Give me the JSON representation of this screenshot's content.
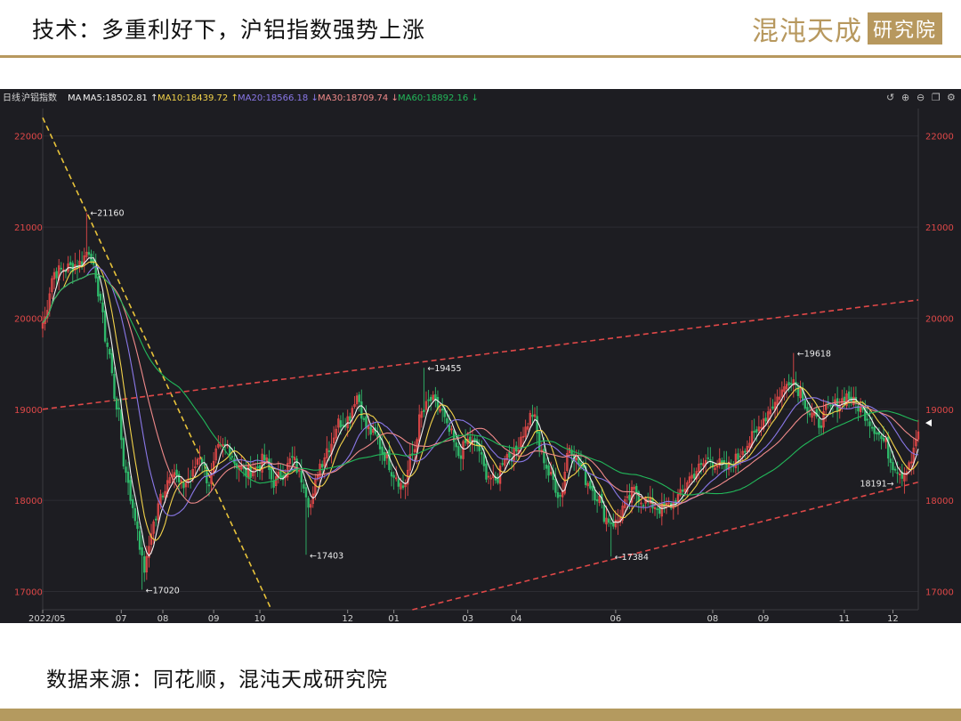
{
  "slide": {
    "title": "技术：多重利好下，沪铝指数强势上涨",
    "logo_main": "混沌天成",
    "logo_box": "研究院",
    "source": "数据来源：同花顺，混沌天成研究院"
  },
  "colors": {
    "background": "#1d1d22",
    "candle_up": "#e04848",
    "candle_down": "#2fb86a",
    "ma5": "#f2f2f2",
    "ma10": "#f3d34a",
    "ma20": "#8a78e8",
    "ma30": "#f08a8a",
    "ma60": "#22b85a",
    "trend_down": "#e8c33a",
    "trend_channel": "#e04848",
    "tick_red": "#e04848",
    "gold": "#b7985e"
  },
  "toolbar": {
    "period": "日线",
    "symbol": "沪铝指数",
    "ma_label": "MA",
    "ma": [
      {
        "label": "MA5:18502.81",
        "arrow": "↑",
        "color": "#f2f2f2"
      },
      {
        "label": "MA10:18439.72",
        "arrow": "↑",
        "color": "#f3d34a"
      },
      {
        "label": "MA20:18566.18",
        "arrow": "↓",
        "color": "#8a78e8"
      },
      {
        "label": "MA30:18709.74",
        "arrow": "↓",
        "color": "#f08a8a"
      },
      {
        "label": "MA60:18892.16",
        "arrow": "↓",
        "color": "#22b85a"
      }
    ],
    "icons": [
      "undo-icon",
      "zoom-in-icon",
      "zoom-out-icon",
      "copy-icon",
      "settings-icon"
    ]
  },
  "chart_data": {
    "type": "candlestick",
    "ylim": [
      16800,
      22300
    ],
    "y_ticks": [
      {
        "value": 22000,
        "label": "22000"
      },
      {
        "value": 21000,
        "label": "21000"
      },
      {
        "value": 20000,
        "label": "20000"
      },
      {
        "value": 19000,
        "label": "19000"
      },
      {
        "value": 18000,
        "label": "18000"
      },
      {
        "value": 17000,
        "label": "17000"
      }
    ],
    "x_ticks": [
      {
        "label": "2022/05",
        "index": 0
      },
      {
        "label": "07",
        "index": 34
      },
      {
        "label": "08",
        "index": 52
      },
      {
        "label": "09",
        "index": 74
      },
      {
        "label": "10",
        "index": 94
      },
      {
        "label": "12",
        "index": 132
      },
      {
        "label": "01",
        "index": 152
      },
      {
        "label": "03",
        "index": 184
      },
      {
        "label": "04",
        "index": 205
      },
      {
        "label": "06",
        "index": 248
      },
      {
        "label": "08",
        "index": 290
      },
      {
        "label": "09",
        "index": 312
      },
      {
        "label": "11",
        "index": 347
      },
      {
        "label": "12",
        "index": 368
      }
    ],
    "bar_count": 380,
    "anchors": [
      {
        "i": 0,
        "v": 19950
      },
      {
        "i": 5,
        "v": 20500
      },
      {
        "i": 10,
        "v": 20550
      },
      {
        "i": 16,
        "v": 20600
      },
      {
        "i": 20,
        "v": 20750
      },
      {
        "i": 24,
        "v": 20300
      },
      {
        "i": 28,
        "v": 19700
      },
      {
        "i": 32,
        "v": 19050
      },
      {
        "i": 36,
        "v": 18300
      },
      {
        "i": 40,
        "v": 17800
      },
      {
        "i": 44,
        "v": 17250
      },
      {
        "i": 48,
        "v": 17750
      },
      {
        "i": 52,
        "v": 18100
      },
      {
        "i": 56,
        "v": 18350
      },
      {
        "i": 60,
        "v": 18150
      },
      {
        "i": 64,
        "v": 18250
      },
      {
        "i": 68,
        "v": 18500
      },
      {
        "i": 72,
        "v": 18200
      },
      {
        "i": 76,
        "v": 18550
      },
      {
        "i": 80,
        "v": 18600
      },
      {
        "i": 84,
        "v": 18400
      },
      {
        "i": 88,
        "v": 18300
      },
      {
        "i": 92,
        "v": 18350
      },
      {
        "i": 96,
        "v": 18450
      },
      {
        "i": 100,
        "v": 18200
      },
      {
        "i": 104,
        "v": 18300
      },
      {
        "i": 108,
        "v": 18450
      },
      {
        "i": 112,
        "v": 18250
      },
      {
        "i": 116,
        "v": 17950
      },
      {
        "i": 120,
        "v": 18400
      },
      {
        "i": 124,
        "v": 18600
      },
      {
        "i": 128,
        "v": 18850
      },
      {
        "i": 132,
        "v": 18900
      },
      {
        "i": 136,
        "v": 19150
      },
      {
        "i": 140,
        "v": 18800
      },
      {
        "i": 144,
        "v": 18700
      },
      {
        "i": 148,
        "v": 18500
      },
      {
        "i": 152,
        "v": 18300
      },
      {
        "i": 156,
        "v": 18150
      },
      {
        "i": 160,
        "v": 18500
      },
      {
        "i": 164,
        "v": 18950
      },
      {
        "i": 168,
        "v": 19100
      },
      {
        "i": 172,
        "v": 19000
      },
      {
        "i": 176,
        "v": 18750
      },
      {
        "i": 180,
        "v": 18500
      },
      {
        "i": 184,
        "v": 18650
      },
      {
        "i": 188,
        "v": 18600
      },
      {
        "i": 192,
        "v": 18300
      },
      {
        "i": 196,
        "v": 18200
      },
      {
        "i": 200,
        "v": 18500
      },
      {
        "i": 204,
        "v": 18500
      },
      {
        "i": 208,
        "v": 18750
      },
      {
        "i": 212,
        "v": 18950
      },
      {
        "i": 216,
        "v": 18500
      },
      {
        "i": 220,
        "v": 18250
      },
      {
        "i": 224,
        "v": 18050
      },
      {
        "i": 228,
        "v": 18600
      },
      {
        "i": 232,
        "v": 18400
      },
      {
        "i": 236,
        "v": 18200
      },
      {
        "i": 240,
        "v": 18050
      },
      {
        "i": 244,
        "v": 17800
      },
      {
        "i": 248,
        "v": 17750
      },
      {
        "i": 252,
        "v": 17950
      },
      {
        "i": 256,
        "v": 18100
      },
      {
        "i": 260,
        "v": 18000
      },
      {
        "i": 264,
        "v": 17950
      },
      {
        "i": 268,
        "v": 17900
      },
      {
        "i": 272,
        "v": 17950
      },
      {
        "i": 276,
        "v": 18050
      },
      {
        "i": 280,
        "v": 18250
      },
      {
        "i": 284,
        "v": 18350
      },
      {
        "i": 288,
        "v": 18450
      },
      {
        "i": 292,
        "v": 18400
      },
      {
        "i": 296,
        "v": 18350
      },
      {
        "i": 300,
        "v": 18450
      },
      {
        "i": 304,
        "v": 18600
      },
      {
        "i": 308,
        "v": 18700
      },
      {
        "i": 312,
        "v": 18900
      },
      {
        "i": 316,
        "v": 19050
      },
      {
        "i": 320,
        "v": 19200
      },
      {
        "i": 324,
        "v": 19350
      },
      {
        "i": 328,
        "v": 19200
      },
      {
        "i": 332,
        "v": 18950
      },
      {
        "i": 336,
        "v": 18850
      },
      {
        "i": 340,
        "v": 19000
      },
      {
        "i": 344,
        "v": 19050
      },
      {
        "i": 348,
        "v": 19150
      },
      {
        "i": 352,
        "v": 19050
      },
      {
        "i": 356,
        "v": 18950
      },
      {
        "i": 360,
        "v": 18800
      },
      {
        "i": 364,
        "v": 18650
      },
      {
        "i": 368,
        "v": 18400
      },
      {
        "i": 372,
        "v": 18300
      },
      {
        "i": 376,
        "v": 18450
      },
      {
        "i": 379,
        "v": 18750
      }
    ],
    "annotations": [
      {
        "label": "21160",
        "index": 19,
        "value": 21160,
        "side": "right"
      },
      {
        "label": "17020",
        "index": 43,
        "value": 17020,
        "side": "right"
      },
      {
        "label": "17403",
        "index": 114,
        "value": 17403,
        "side": "right"
      },
      {
        "label": "19455",
        "index": 165,
        "value": 19455,
        "side": "right"
      },
      {
        "label": "17384",
        "index": 246,
        "value": 17384,
        "side": "right"
      },
      {
        "label": "19618",
        "index": 325,
        "value": 19618,
        "side": "right"
      },
      {
        "label": "18191",
        "index": 370,
        "value": 18191,
        "side": "left"
      }
    ],
    "trendlines": [
      {
        "name": "down-trendline",
        "from": {
          "index": 0,
          "value": 22200
        },
        "to": {
          "index": 99,
          "value": 16800
        },
        "color": "#e8c33a"
      },
      {
        "name": "channel-upper",
        "from": {
          "index": 0,
          "value": 19000
        },
        "to": {
          "index": 379,
          "value": 20200
        },
        "color": "#e04848"
      },
      {
        "name": "channel-lower",
        "from": {
          "index": 160,
          "value": 16800
        },
        "to": {
          "index": 379,
          "value": 18200
        },
        "color": "#e04848"
      }
    ],
    "last_marker": {
      "value": 18850
    }
  }
}
